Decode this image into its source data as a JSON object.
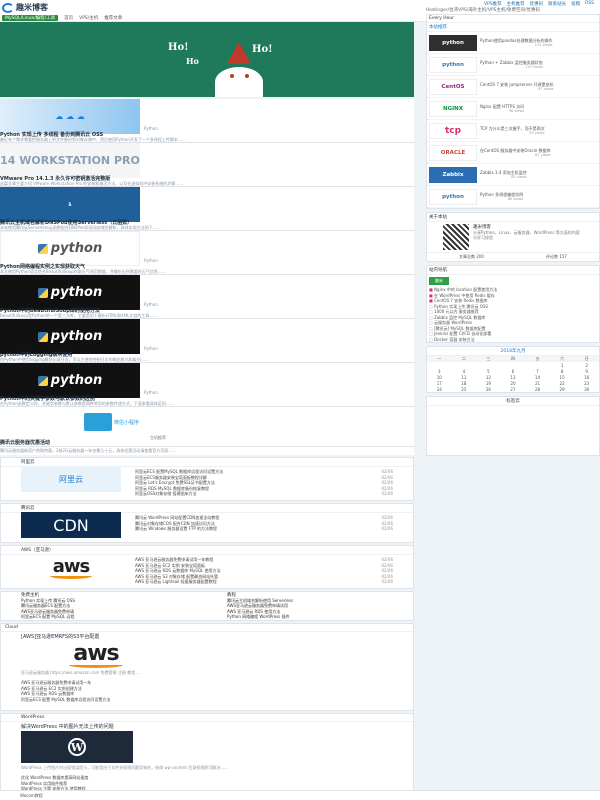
{
  "header": {
    "logo_text": "趣米博客",
    "subtitle": "Hostinger/台湾VPS/海外主机/VPS主机/免费空间/优惠码",
    "toplinks": [
      "VPS推荐",
      "主机推荐",
      "优惠码",
      "联系站长",
      "投稿",
      "RSS"
    ],
    "nav": [
      "MySQL/Linux/编程/工具",
      "首页",
      "VPS/主机",
      "推荐文章"
    ]
  },
  "banner": {
    "ho1": "Ho!",
    "ho2": "Ho!",
    "ho3": "Ho"
  },
  "posts": [
    {
      "title": "Python 实现上传 多线程 备份到腾讯云 OSS",
      "excerpt": "最近有个需求需要把服务器上的文件备份到对象存储中，然后使用Python开发了一个多线程上传脚本……",
      "side": "Python"
    },
    {
      "title": "VMware Pro 14.1.3 永久许可密钥激活完整版",
      "excerpt": "这篇文章主要介绍 VMware Workstation Pro 的安装和激活方法，以及在虚拟机中安装系统的步骤……",
      "side": ""
    },
    {
      "title": "腾讯云主机域名解析DNSPod使用Serverless（云函数）",
      "excerpt": "本站使用腾讯云Serverless云函数配合DNSPod实现动态域名解析，具体实现方法如下……",
      "side": ""
    },
    {
      "title": "Python网络编程实例之实现获取天气",
      "excerpt": "本文使用Python语言结合BeautifulSoup抓取天气网页数据，并解析出所需要的天气信息……",
      "side": "Python"
    },
    {
      "title": "Python中的BeautifulSoup库的使用方法",
      "excerpt": "BeautifulSoup是Python的一个第三方库，主要是用于解析HTML和XML文档的工具……",
      "side": "Python"
    },
    {
      "title": "python中的Logging模块使用",
      "excerpt": "在Python中使用logging模块记录日志，可以方便地控制日志的输出格式和级别……",
      "side": "Python"
    },
    {
      "title": "Python中的关键字参数与默认参数的区别",
      "excerpt": "在Python函数定义时，关键字参数与默认参数是两种常用的参数传递方式，下面来看具体区别……",
      "side": "Python"
    }
  ],
  "wechat_post": {
    "title": "微信小程序",
    "caption": "主机推荐",
    "footer_title": "腾讯云服务器优惠活动",
    "excerpt": "腾讯云服务器新用户首购特惠，2核2G云服务器一年仅需几十元，具体优惠活动请查看官方页面……"
  },
  "sections": [
    {
      "title": "阿里云",
      "logo": "阿里云",
      "rows": [
        {
          "t": "阿里云ECS 配置MySQL 数据库远程访问设置方法",
          "d": "02/06"
        },
        {
          "t": "阿里云ECS服务器安装宝塔面板教程详解",
          "d": "02/06"
        },
        {
          "t": "阿里云 Let's Encrypt 免费SSL证书配置方法",
          "d": "02/06"
        },
        {
          "t": "阿里云 RDS MySQL 数据库备份恢复教程",
          "d": "02/06"
        },
        {
          "t": "阿里云OSS对象存储 搭建图床方法",
          "d": "02/06"
        }
      ]
    },
    {
      "title": "腾讯云",
      "logo": "CDN",
      "rows": [
        {
          "t": "腾讯云 WordPress 网站配置CDN加速全站教程",
          "d": "02/06"
        },
        {
          "t": "腾讯云对象存储COS 配合CDN 加速访问方法",
          "d": "02/06"
        },
        {
          "t": "腾讯云 Windows 服务器设置 FTP 的方法教程",
          "d": "02/06"
        }
      ]
    },
    {
      "title": "AWS（亚马逊）",
      "logo": "aws",
      "rows": [
        {
          "t": "AWS 亚马逊云服务器免费申请试用一年教程",
          "d": "02/06"
        },
        {
          "t": "AWS 亚马逊云 EC2 实例 安装宝塔面板",
          "d": "02/06"
        },
        {
          "t": "AWS 亚马逊云 RDS 云数据库 MySQL 使用方法",
          "d": "02/06"
        },
        {
          "t": "AWS 亚马逊云 S3 对象存储 配置静态网站托管",
          "d": "02/06"
        },
        {
          "t": "AWS 亚马逊云 Lightsail 轻量服务器配置教程",
          "d": "02/06"
        }
      ]
    }
  ],
  "double_sec": {
    "left_title": "免费主机",
    "right_title": "教程",
    "left": [
      "Python 实现上传 腾讯云 OSS",
      "腾讯云服务器ECS 配置方法",
      "AWS亚马逊云服务器免费申请",
      "阿里云ECS 配置 MySQL 远程"
    ],
    "right": [
      "腾讯云主机域名解析使用 Serverless",
      "AWS亚马逊云服务器免费申请试用",
      "AWS 亚马逊云 RDS 使用方法",
      "Python 网络编程 WordPress 插件"
    ]
  },
  "cloud_sec": {
    "title": "Cloud",
    "link": "[AWS]亚马逊EMRFS的S3平台配置",
    "meta": "亚马逊云服务器 https://aws.amazon.com 免费套餐 注册 教程 …"
  },
  "cloud_rows": [
    "AWS 亚马逊云服务器免费申请试用一年",
    "AWS 亚马逊云 EC2 实例创建方法",
    "AWS 亚马逊云 RDS 云数据库",
    "阿里云ECS 配置 MySQL 数据库远程访问设置方法"
  ],
  "wp_sec": {
    "title": "WordPress",
    "link": "解决WordPress 中的图片无法上传的问题",
    "excerpt": "WordPress 上传图片时出现错误提示，可能是由于文件夹权限问题导致的，修改 wp-content 目录权限即可解决……"
  },
  "wp_rows": [
    "优化 WordPress 数据库提高网站速度",
    "WordPress 实用插件推荐",
    "WordPress 主题 安装方法 使用教程",
    "WordPress 后台 登录 速度优化方法"
  ],
  "footer_label": "Wacom教程",
  "sidebar": {
    "hot_title": "Every Hour",
    "recommend_title": "本站推荐",
    "hot": [
      {
        "logo": "python",
        "t": "Python使用pandas处理数据分析的操作",
        "v": "131 views"
      },
      {
        "logo": "python",
        "t": "Python + Zabbix 监控服务器状态",
        "v": "119 views"
      },
      {
        "logo": "CentOS",
        "t": "CentOS 7 安装 Jumpserver 开源堡垒机",
        "v": "97 views"
      },
      {
        "logo": "NGINX",
        "t": "Nginx 配置 HTTPS 访问",
        "v": "96 views"
      },
      {
        "logo": "tcp",
        "t": "TCP 为什么是三次握手，而不是两次",
        "v": "95 views"
      },
      {
        "logo": "ORACLE",
        "t": "在CentOS 服务器中安装Oracle 数据库",
        "v": "87 views"
      },
      {
        "logo": "Zabbix",
        "t": "Zabbix 3.4 添加主机监控",
        "v": "85 views"
      },
      {
        "logo": "python",
        "t": "Python 多线程编程实例",
        "v": "80 views"
      }
    ],
    "author_title": "关于本站",
    "author_name": "趣米博客",
    "author_desc": "分享Python、Linux、云服务器、WordPress 等方面的内容与学习经验",
    "author_stats": [
      "文章总数 200",
      "评论数 157"
    ],
    "links_title": "站内导航",
    "links_btn": "趣米",
    "links": [
      "Nginx 中的 location 配置使用方法",
      "在 WordPress 中使用 Redis 缓存",
      "CentOS 7 安装 Redis 数据库",
      "Python 实现上传 腾讯云 OSS",
      "1000 元以内 服务器推荐",
      "Zabbix 监控 MySQL 数据库",
      "云服务器 WordPress",
      "[腾讯云] MySQL 数据库配置",
      "Jenkins 配置 CI/CD 自动化部署",
      "Docker 容器 安装方法"
    ],
    "cal_title": "2018年九月",
    "cal_head": [
      "一",
      "二",
      "三",
      "四",
      "五",
      "六",
      "日"
    ],
    "cal_rows": [
      [
        "",
        "",
        "",
        "",
        "",
        "1",
        "2"
      ],
      [
        "3",
        "4",
        "5",
        "6",
        "7",
        "8",
        "9"
      ],
      [
        "10",
        "11",
        "12",
        "13",
        "14",
        "15",
        "16"
      ],
      [
        "17",
        "18",
        "19",
        "20",
        "21",
        "22",
        "23"
      ],
      [
        "24",
        "25",
        "26",
        "27",
        "28",
        "29",
        "30"
      ]
    ],
    "tags_title": "标签云"
  },
  "colors": {
    "accent": "#1c7ed6",
    "green": "#2b8a3e",
    "banner": "#1f7a5c"
  }
}
